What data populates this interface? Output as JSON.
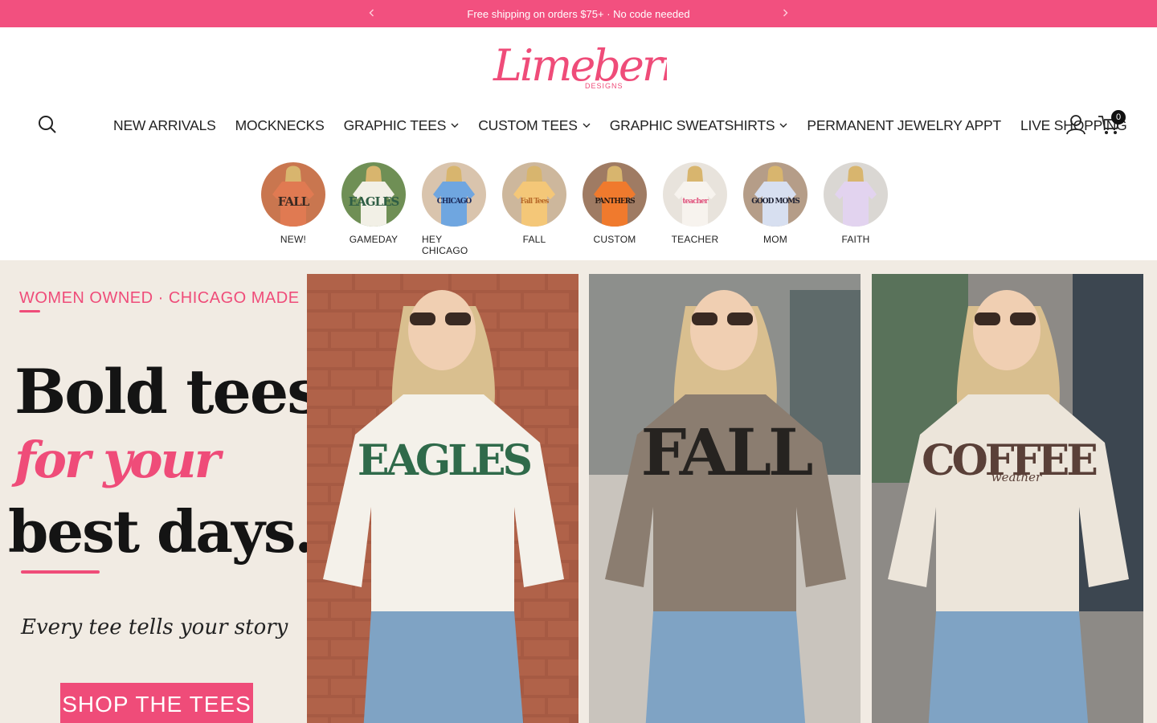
{
  "announcement": {
    "text": "Free shipping on orders $75+ · No code needed",
    "prev_icon": "chevron-left-icon",
    "next_icon": "chevron-right-icon"
  },
  "brand": {
    "name": "Limeberry",
    "sub": "DESIGNS",
    "accent": "#f2507f"
  },
  "nav": {
    "items": [
      {
        "label": "NEW ARRIVALS",
        "dropdown": false
      },
      {
        "label": "MOCKNECKS",
        "dropdown": false
      },
      {
        "label": "GRAPHIC TEES",
        "dropdown": true
      },
      {
        "label": "CUSTOM TEES",
        "dropdown": true
      },
      {
        "label": "GRAPHIC SWEATSHIRTS",
        "dropdown": true
      },
      {
        "label": "PERMANENT JEWELRY APPT",
        "dropdown": false
      },
      {
        "label": "LIVE SHOPPING",
        "dropdown": false
      }
    ],
    "cart_count": "0",
    "icons": [
      "search-icon",
      "account-icon",
      "cart-icon"
    ]
  },
  "categories": [
    {
      "label": "NEW!",
      "shirt": "FALL",
      "bg": "#c9764f",
      "shirt_color": "#e07a52",
      "text_color": "#3a2a22"
    },
    {
      "label": "GAMEDAY",
      "shirt": "EAGLES",
      "bg": "#6f8f55",
      "shirt_color": "#f2f0e6",
      "text_color": "#2f5e45"
    },
    {
      "label": "HEY CHICAGO",
      "shirt": "CHICAGO",
      "bg": "#d9c4ad",
      "shirt_color": "#6fa6e0",
      "text_color": "#1b2a5a"
    },
    {
      "label": "FALL",
      "shirt": "Fall Tees",
      "bg": "#cdb79c",
      "shirt_color": "#f4c778",
      "text_color": "#b86a2a"
    },
    {
      "label": "CUSTOM",
      "shirt": "PANTHERS",
      "bg": "#9f7b63",
      "shirt_color": "#f07a2d",
      "text_color": "#2a1a12"
    },
    {
      "label": "TEACHER",
      "shirt": "teacher",
      "bg": "#e8e3dc",
      "shirt_color": "#f7f3ee",
      "text_color": "#e0557f"
    },
    {
      "label": "MOM",
      "shirt": "GOOD MOMS",
      "bg": "#b59d88",
      "shirt_color": "#d7dff0",
      "text_color": "#1f2233"
    },
    {
      "label": "FAITH",
      "shirt": "",
      "bg": "#dad7d3",
      "shirt_color": "#e2d3ef",
      "text_color": "#6a4c8a"
    }
  ],
  "hero": {
    "tagline": "WOMEN OWNED · CHICAGO MADE",
    "line1": "Bold tees",
    "line2": "for your",
    "line3": "best days.",
    "subline": "Every tee tells your story",
    "cta": "SHOP THE TEES",
    "photos": [
      {
        "shirt_text": "EAGLES",
        "shirt_color": "#f4f1ea",
        "text_color": "#2f6a4a",
        "bg": "#a65a43"
      },
      {
        "shirt_text": "FALL",
        "shirt_color": "#8b7d70",
        "text_color": "#262320",
        "bg": "#c9c4bd"
      },
      {
        "shirt_text": "COFFEE",
        "shirt_color": "#ece5da",
        "text_color": "#5a4038",
        "bg": "#8d8a86",
        "script": "weather"
      }
    ]
  }
}
